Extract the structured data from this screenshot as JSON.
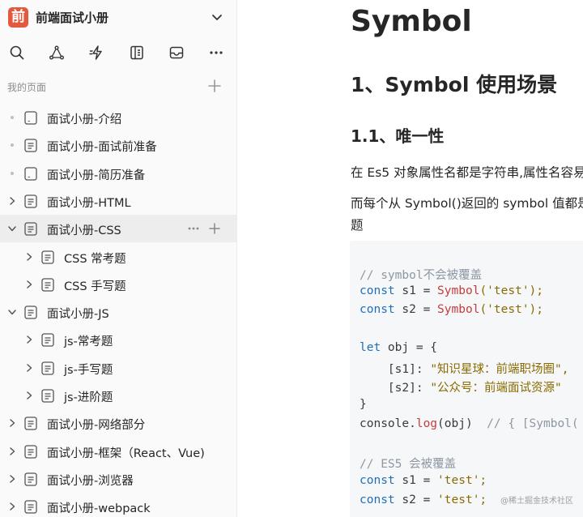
{
  "sidebar": {
    "logo_char": "前",
    "book_title": "前端面试小册",
    "section_label": "我的页面",
    "toolbar_icons": [
      "search-icon",
      "graph-icon",
      "lightning-icon",
      "table-icon",
      "inbox-icon",
      "more-icon"
    ],
    "items": [
      {
        "label": "面试小册-介绍",
        "lead": "dot",
        "icon": "doc-blank"
      },
      {
        "label": "面试小册-面试前准备",
        "lead": "dot",
        "icon": "doc-lines"
      },
      {
        "label": "面试小册-简历准备",
        "lead": "dot",
        "icon": "doc-blank"
      },
      {
        "label": "面试小册-HTML",
        "lead": "chevron-right",
        "icon": "doc-lines"
      },
      {
        "label": "面试小册-CSS",
        "lead": "chevron-down",
        "icon": "doc-lines",
        "active": true
      },
      {
        "label": "CSS 常考题",
        "lead": "chevron-right",
        "icon": "doc-lines",
        "child": true
      },
      {
        "label": "CSS 手写题",
        "lead": "chevron-right",
        "icon": "doc-lines",
        "child": true
      },
      {
        "label": "面试小册-JS",
        "lead": "chevron-down",
        "icon": "doc-lines"
      },
      {
        "label": "js-常考题",
        "lead": "chevron-right",
        "icon": "doc-lines",
        "child": true
      },
      {
        "label": "js-手写题",
        "lead": "chevron-right",
        "icon": "doc-lines",
        "child": true
      },
      {
        "label": "js-进阶题",
        "lead": "chevron-right",
        "icon": "doc-lines",
        "child": true
      },
      {
        "label": "面试小册-网络部分",
        "lead": "chevron-right",
        "icon": "doc-lines"
      },
      {
        "label": "面试小册-框架（React、Vue)",
        "lead": "chevron-right",
        "icon": "doc-lines"
      },
      {
        "label": "面试小册-浏览器",
        "lead": "chevron-right",
        "icon": "doc-lines"
      },
      {
        "label": "面试小册-webpack",
        "lead": "chevron-right",
        "icon": "doc-lines"
      }
    ]
  },
  "content": {
    "title": "Symbol",
    "h2": "1、Symbol 使用场景",
    "h3": "1.1、唯一性",
    "para1": "在 Es5 对象属性名都是字符串,属性名容易",
    "para2_line1": "而每个从 Symbol()返回的 symbol 值都是",
    "para2_line2": "题",
    "code": {
      "l1": "// symbol不会被覆盖",
      "l2_kw": "const",
      "l2_var": " s1 = ",
      "l2_fn": "Symbol",
      "l2_str": "('test');",
      "l3_kw": "const",
      "l3_var": " s2 = ",
      "l3_fn": "Symbol",
      "l3_str": "('test');",
      "l5_kw": "let",
      "l5_rest": " obj = {",
      "l6_key": "    [s1]: ",
      "l6_str": "\"知识星球：前端职场圈\",",
      "l7_key": "    [s2]: ",
      "l7_str": "\"公众号：前端面试资源\"",
      "l8": "}",
      "l9_a": "console.",
      "l9_fn": "log",
      "l9_b": "(obj)  ",
      "l9_com": "// { [Symbol(",
      "l11": "// ES5 会被覆盖",
      "l12_kw": "const",
      "l12_var": " s1 = ",
      "l12_str": "'test';",
      "l13_kw": "const",
      "l13_var": " s2 = ",
      "l13_str": "'test';"
    },
    "watermark": "@稀土掘金技术社区"
  }
}
